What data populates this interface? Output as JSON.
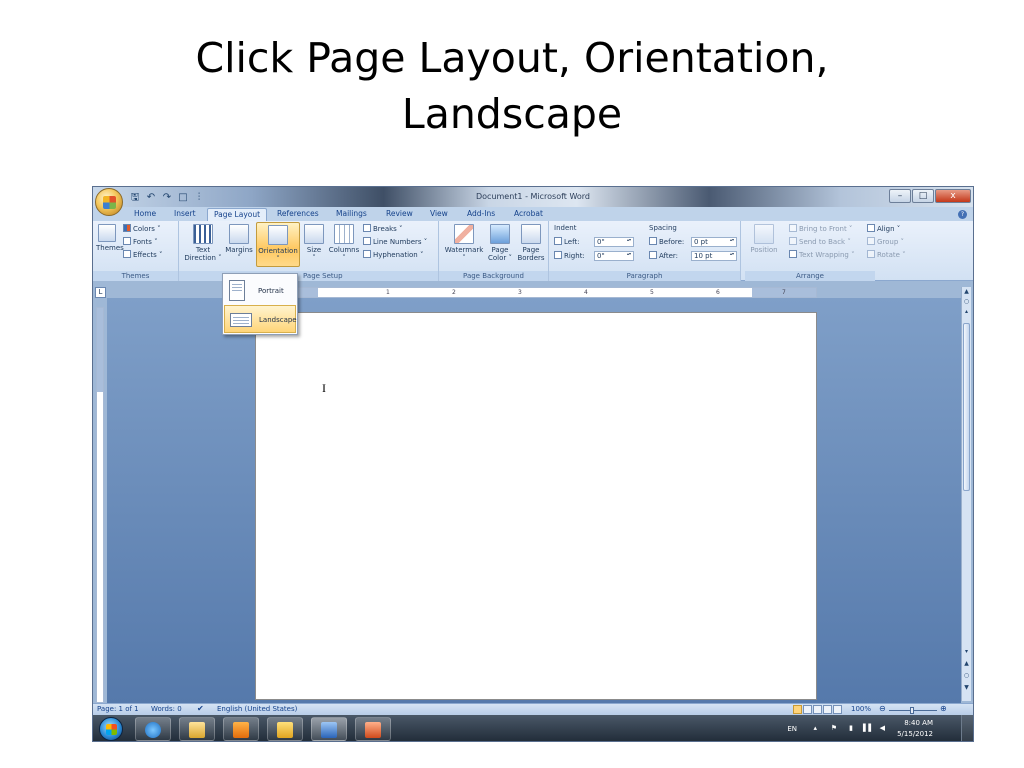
{
  "slide": {
    "title_line1": "Click Page Layout, Orientation,",
    "title_line2": "Landscape"
  },
  "window": {
    "title": "Document1 - Microsoft Word",
    "controls": [
      "–",
      "□",
      "x"
    ]
  },
  "tabs": [
    {
      "label": "Home"
    },
    {
      "label": "Insert"
    },
    {
      "label": "Page Layout",
      "active": true
    },
    {
      "label": "References"
    },
    {
      "label": "Mailings"
    },
    {
      "label": "Review"
    },
    {
      "label": "View"
    },
    {
      "label": "Add-Ins"
    },
    {
      "label": "Acrobat"
    }
  ],
  "ribbon": {
    "themes": {
      "group_label": "Themes",
      "themes_btn": "Themes",
      "colors": "Colors ˅",
      "fonts": "Fonts ˅",
      "effects": "Effects ˅"
    },
    "page_setup": {
      "group_label": "Page Setup",
      "text_direction_1": "Text",
      "text_direction_2": "Direction ˅",
      "margins": "Margins",
      "orientation": "Orientation",
      "size": "Size",
      "columns": "Columns",
      "breaks": "Breaks ˅",
      "line_numbers": "Line Numbers ˅",
      "hyphenation": "Hyphenation ˅",
      "dropdown_arrow": "˅"
    },
    "page_background": {
      "group_label": "Page Background",
      "watermark": "Watermark",
      "page_color_1": "Page",
      "page_color_2": "Color ˅",
      "page_borders_1": "Page",
      "page_borders_2": "Borders"
    },
    "paragraph": {
      "group_label": "Paragraph",
      "indent": "Indent",
      "left_label": "Left:",
      "left_value": "0\"",
      "right_label": "Right:",
      "right_value": "0\"",
      "spacing": "Spacing",
      "before_label": "Before:",
      "before_value": "0 pt",
      "after_label": "After:",
      "after_value": "10 pt"
    },
    "arrange": {
      "group_label": "Arrange",
      "position": "Position",
      "bring_to_front": "Bring to Front ˅",
      "send_to_back": "Send to Back ˅",
      "text_wrapping": "Text Wrapping ˅",
      "align": "Align ˅",
      "group": "Group ˅",
      "rotate": "Rotate ˅"
    }
  },
  "orientation_menu": {
    "items": [
      {
        "label": "Portrait",
        "selected": false
      },
      {
        "label": "Landscape",
        "selected": true
      }
    ]
  },
  "ruler": {
    "numbers": [
      "1",
      "2",
      "3",
      "4",
      "5",
      "6",
      "7"
    ],
    "tab_selector": "L"
  },
  "document": {
    "cursor": "I"
  },
  "status_bar": {
    "page": "Page: 1 of 1",
    "words": "Words: 0",
    "language": "English (United States)",
    "zoom": "100%"
  },
  "taskbar": {
    "language": "EN",
    "time": "8:40 AM",
    "date": "5/15/2012"
  },
  "colors": {
    "accent_orange": "#ffc860",
    "ribbon_blue": "#d2e1f3",
    "workspace_blue": "#5579ab"
  }
}
